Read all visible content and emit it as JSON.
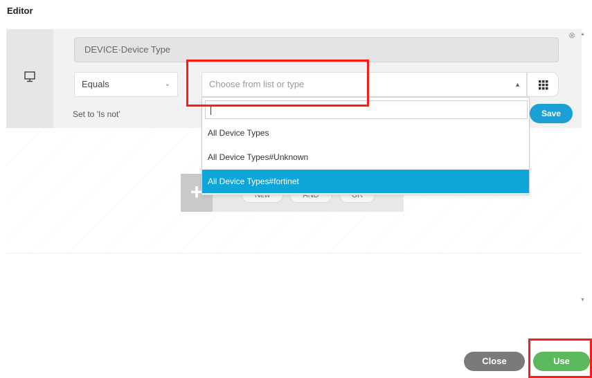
{
  "window": {
    "title": "Editor"
  },
  "condition": {
    "attribute": "DEVICE·Device Type",
    "operator": "Equals",
    "value_placeholder": "Choose from list or type",
    "set_is_not_label": "Set to 'Is not'",
    "save_label": "Save",
    "close_glyph": "⊗",
    "monitor_icon": "monitor-icon",
    "grid_icon": "grid-icon"
  },
  "dropdown": {
    "search_value": "",
    "options": [
      {
        "label": "All Device Types",
        "selected": false
      },
      {
        "label": "All Device Types#Unknown",
        "selected": false
      },
      {
        "label": "All Device Types#fortinet",
        "selected": true
      }
    ]
  },
  "canvas": {
    "new_label": "New",
    "and_label": "AND",
    "or_label": "OR",
    "add_icon": "plus-icon"
  },
  "footer": {
    "close_label": "Close",
    "use_label": "Use"
  },
  "colors": {
    "accent": "#0ea5d8",
    "save": "#1a9fd6",
    "use": "#5cb85c",
    "close": "#7a7a7a",
    "highlight": "#ff1a1a"
  }
}
